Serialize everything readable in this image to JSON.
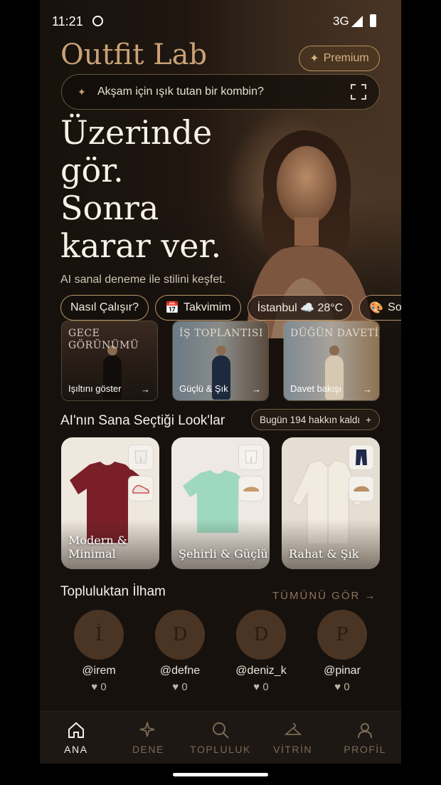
{
  "status_bar": {
    "time": "11:21",
    "network": "3G"
  },
  "header": {
    "brand": "Outfit Lab",
    "premium_label": "Premium"
  },
  "search": {
    "placeholder": "Akşam için ışık tutan bir kombin?"
  },
  "hero": {
    "headline_lines": [
      "Üzerinde",
      "gör.",
      "Sonra",
      "karar ver."
    ],
    "subtitle": "AI sanal deneme ile stilini keşfet."
  },
  "chips": [
    {
      "label": "Nasıl Çalışır?",
      "icon": ""
    },
    {
      "label": "Takvimim",
      "icon": "calendar-icon"
    },
    {
      "label": "İstanbul ☁️ 28°C",
      "icon": ""
    },
    {
      "label": "Sof",
      "icon": "palette-icon"
    }
  ],
  "occasions": [
    {
      "title": "GECE GÖRÜNÜMÜ",
      "label": "Işıltını göster",
      "arrow": "→"
    },
    {
      "title": "İŞ TOPLANTISI",
      "label": "Güçlü & Şık",
      "arrow": "→"
    },
    {
      "title": "DÜĞÜN DAVETİ",
      "label": "Davet bakışı",
      "arrow": "→"
    }
  ],
  "looks_section": {
    "title": "AI'nın Sana Seçtiği Look'lar",
    "credits": "Bugün 194 hakkın kaldı",
    "credits_plus": "+",
    "items": [
      {
        "name": "Modern & Minimal",
        "top_color": "#7a1f28",
        "bg": "#efe8df"
      },
      {
        "name": "Şehirli & Güçlü",
        "top_color": "#9ed8bf",
        "bg": "#eee9e2"
      },
      {
        "name": "Rahat & Şık",
        "top_color": "#ebe3d6",
        "bg": "#e6ded2"
      }
    ]
  },
  "community": {
    "title": "Topluluktan İlham",
    "see_all": "TÜMÜNÜ GÖR →",
    "users": [
      {
        "initial": "İ",
        "handle": "@irem",
        "likes": "0"
      },
      {
        "initial": "D",
        "handle": "@defne",
        "likes": "0"
      },
      {
        "initial": "D",
        "handle": "@deniz_k",
        "likes": "0"
      },
      {
        "initial": "P",
        "handle": "@pinar",
        "likes": "0"
      }
    ]
  },
  "nav": [
    {
      "label": "ANA",
      "icon": "home-icon",
      "active": true
    },
    {
      "label": "DENE",
      "icon": "sparkle-icon",
      "active": false
    },
    {
      "label": "TOPLULUK",
      "icon": "search-icon",
      "active": false
    },
    {
      "label": "VİTRİN",
      "icon": "hanger-icon",
      "active": false
    },
    {
      "label": "PROFİL",
      "icon": "profile-icon",
      "active": false
    }
  ],
  "colors": {
    "accent": "#c9a276",
    "background": "#16110d"
  }
}
